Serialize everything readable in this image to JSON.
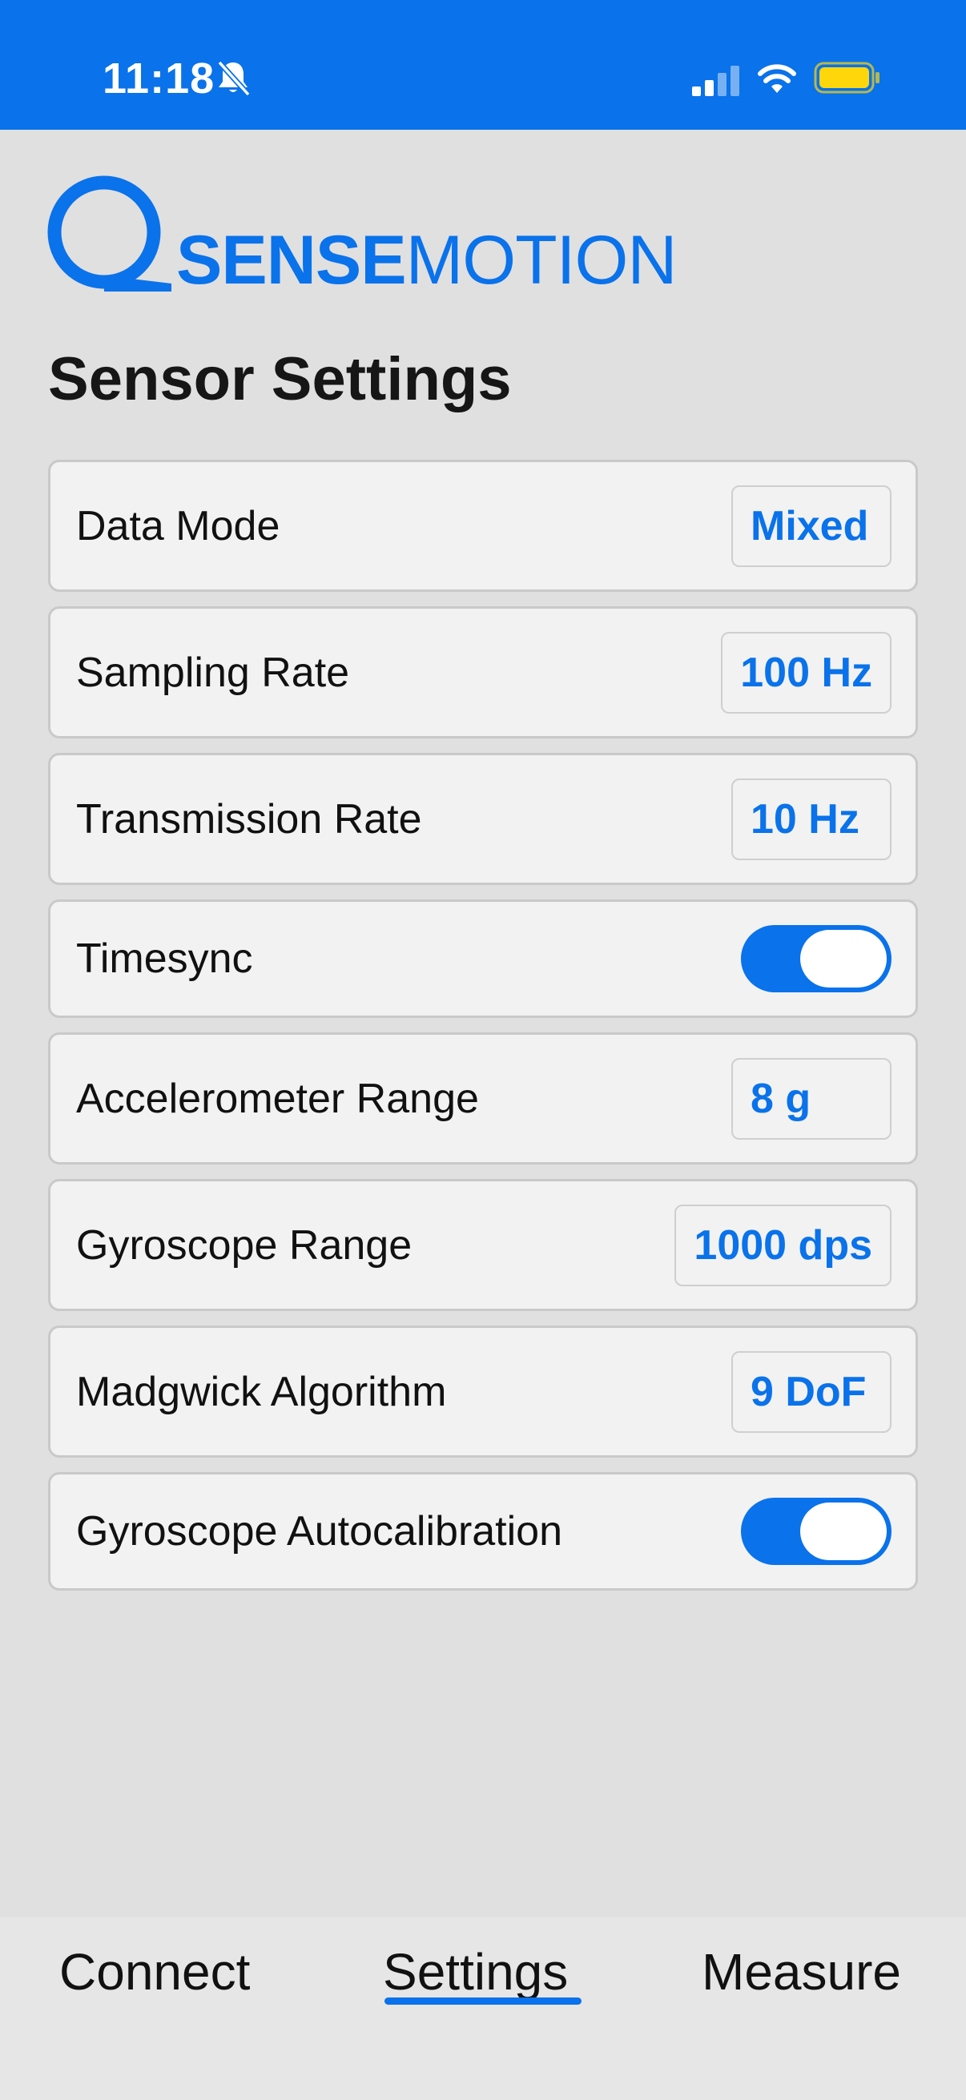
{
  "status_bar": {
    "time": "11:18",
    "icons": [
      "bell-slash-icon",
      "cellular-signal-icon",
      "wifi-icon",
      "battery-icon"
    ],
    "background_color": "#0a72ea",
    "battery_color": "#ffd60a"
  },
  "logo": {
    "strong_text": "SENSE",
    "light_text": "MOTION",
    "color": "#0a72ea"
  },
  "page_title": "Sensor Settings",
  "settings": [
    {
      "label": "Data Mode",
      "type": "select",
      "value": "Mixed"
    },
    {
      "label": "Sampling Rate",
      "type": "select",
      "value": "100 Hz"
    },
    {
      "label": "Transmission Rate",
      "type": "select",
      "value": "10 Hz"
    },
    {
      "label": "Timesync",
      "type": "toggle",
      "on": true
    },
    {
      "label": "Accelerometer Range",
      "type": "select",
      "value": "8 g"
    },
    {
      "label": "Gyroscope Range",
      "type": "select",
      "value": "1000 dps"
    },
    {
      "label": "Madgwick Algorithm",
      "type": "select",
      "value": "9 DoF"
    },
    {
      "label": "Gyroscope Autocalibration",
      "type": "toggle",
      "on": true
    }
  ],
  "tabs": [
    {
      "label": "Connect",
      "active": false
    },
    {
      "label": "Settings",
      "active": true
    },
    {
      "label": "Measure",
      "active": false
    }
  ],
  "colors": {
    "accent": "#0a72ea",
    "background": "#e0e0e0",
    "row_background": "#f2f2f2"
  }
}
